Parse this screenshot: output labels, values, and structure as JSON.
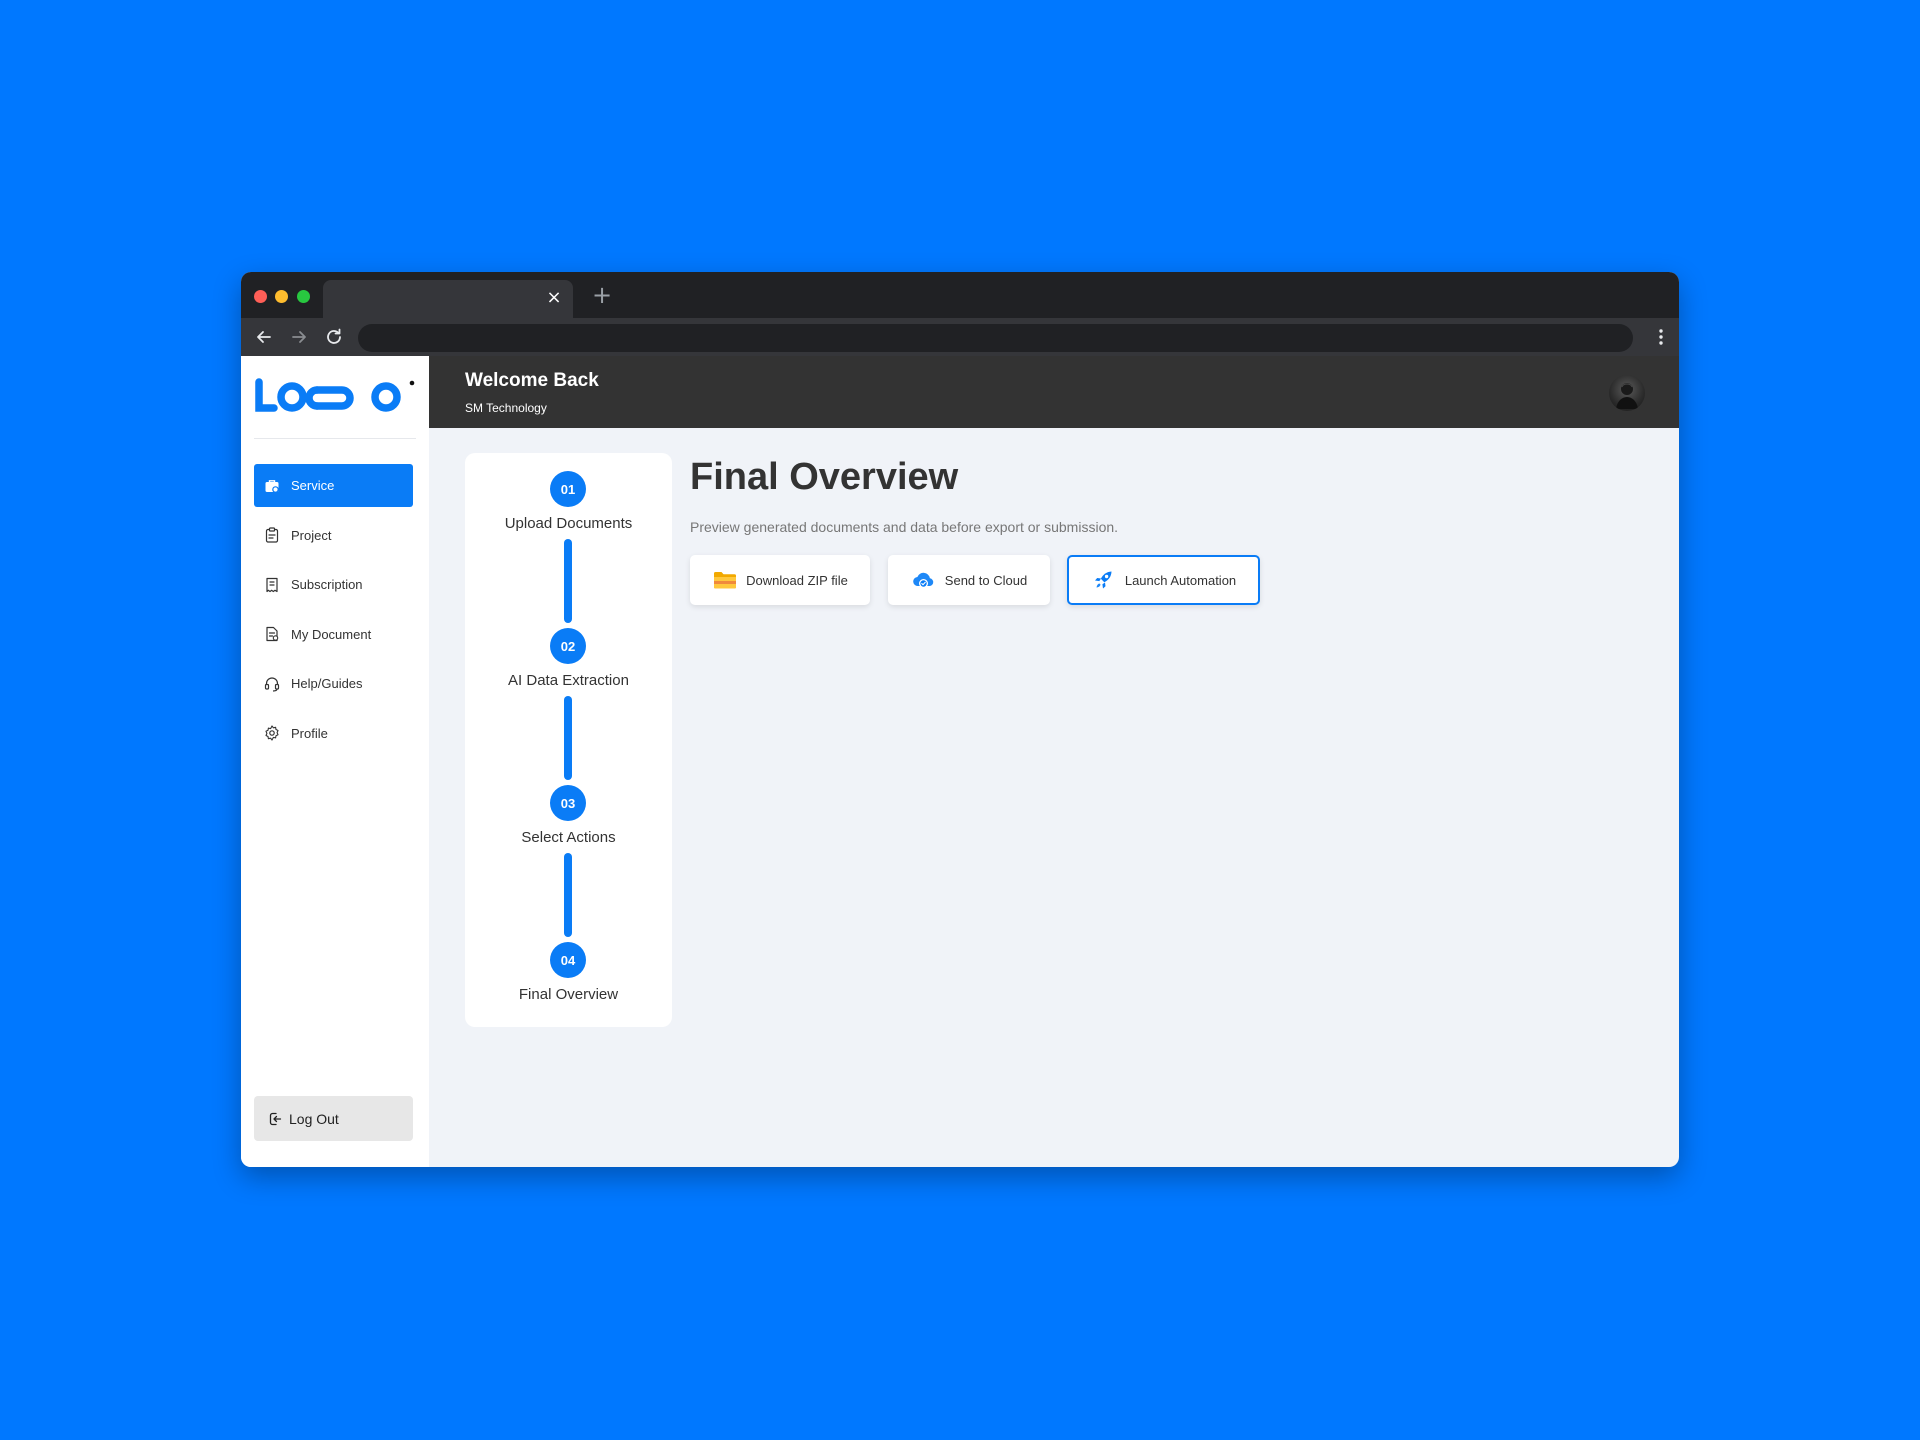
{
  "browser": {
    "tab_close_icon": "close-icon",
    "new_tab_icon": "plus-icon",
    "tab_close_glyph": "×",
    "new_tab_glyph": "+"
  },
  "app": {
    "brand_color": "#0A7CF6",
    "logo_text": "LOGO"
  },
  "header": {
    "title": "Welcome Back",
    "subtitle": "SM Technology"
  },
  "sidebar": {
    "items": [
      {
        "label": "Service",
        "icon": "briefcase-icon",
        "active": true
      },
      {
        "label": "Project",
        "icon": "clipboard-icon",
        "active": false
      },
      {
        "label": "Subscription",
        "icon": "receipt-icon",
        "active": false
      },
      {
        "label": "My Document",
        "icon": "document-icon",
        "active": false
      },
      {
        "label": "Help/Guides",
        "icon": "headset-icon",
        "active": false
      },
      {
        "label": "Profile",
        "icon": "gear-icon",
        "active": false
      }
    ],
    "logout_label": "Log Out"
  },
  "stepper": {
    "steps": [
      {
        "number": "01",
        "label": "Upload Documents"
      },
      {
        "number": "02",
        "label": "AI Data Extraction"
      },
      {
        "number": "03",
        "label": "Select Actions"
      },
      {
        "number": "04",
        "label": "Final Overview"
      }
    ]
  },
  "main": {
    "title": "Final Overview",
    "description": "Preview generated documents and data before export or submission.",
    "actions": [
      {
        "label": "Download ZIP file",
        "icon": "folder-zip-icon",
        "selected": false
      },
      {
        "label": "Send to Cloud",
        "icon": "cloud-icon",
        "selected": false
      },
      {
        "label": "Launch Automation",
        "icon": "rocket-icon",
        "selected": true
      }
    ]
  }
}
